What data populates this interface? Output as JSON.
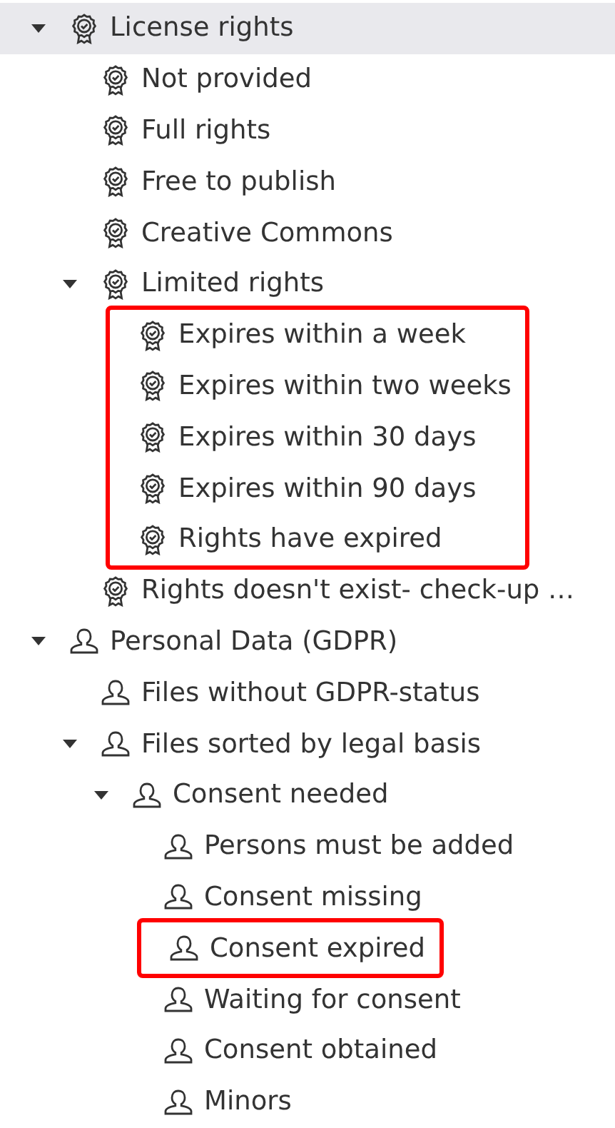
{
  "items": [
    {
      "label": "License rights",
      "kind": "license",
      "selected": true,
      "expanded": true,
      "highlighted": false,
      "children": [
        {
          "label": "Not provided",
          "kind": "license",
          "selected": false,
          "highlighted": false
        },
        {
          "label": "Full rights",
          "kind": "license",
          "selected": false,
          "highlighted": false
        },
        {
          "label": "Free to publish",
          "kind": "license",
          "selected": false,
          "highlighted": false
        },
        {
          "label": "Creative Commons",
          "kind": "license",
          "selected": false,
          "highlighted": false
        },
        {
          "label": "Limited rights",
          "kind": "license",
          "selected": false,
          "expanded": true,
          "highlighted": false,
          "children": [
            {
              "label": "Expires within a week",
              "kind": "license",
              "selected": false,
              "highlighted": true
            },
            {
              "label": "Expires within two weeks",
              "kind": "license",
              "selected": false,
              "highlighted": true
            },
            {
              "label": "Expires within 30 days",
              "kind": "license",
              "selected": false,
              "highlighted": true
            },
            {
              "label": "Expires within 90 days",
              "kind": "license",
              "selected": false,
              "highlighted": true
            },
            {
              "label": "Rights have expired",
              "kind": "license",
              "selected": false,
              "highlighted": true
            }
          ]
        },
        {
          "label": "Rights doesn't exist- check-up …",
          "kind": "license",
          "selected": false,
          "highlighted": false
        }
      ]
    },
    {
      "label": "Personal Data (GDPR)",
      "kind": "person",
      "selected": false,
      "expanded": true,
      "highlighted": false,
      "children": [
        {
          "label": "Files without GDPR-status",
          "kind": "person",
          "selected": false,
          "highlighted": false
        },
        {
          "label": "Files sorted by legal basis",
          "kind": "person",
          "selected": false,
          "expanded": true,
          "highlighted": false,
          "children": [
            {
              "label": "Consent needed",
              "kind": "person",
              "selected": false,
              "expanded": true,
              "highlighted": false,
              "children": [
                {
                  "label": "Persons must be added",
                  "kind": "person",
                  "selected": false,
                  "highlighted": false
                },
                {
                  "label": "Consent missing",
                  "kind": "person",
                  "selected": false,
                  "highlighted": false
                },
                {
                  "label": "Consent expired",
                  "kind": "person",
                  "selected": false,
                  "highlighted": true
                },
                {
                  "label": "Waiting for consent",
                  "kind": "person",
                  "selected": false,
                  "highlighted": false
                },
                {
                  "label": "Consent obtained",
                  "kind": "person",
                  "selected": false,
                  "highlighted": false
                },
                {
                  "label": "Minors",
                  "kind": "person",
                  "selected": false,
                  "highlighted": false
                }
              ]
            }
          ]
        }
      ]
    }
  ]
}
